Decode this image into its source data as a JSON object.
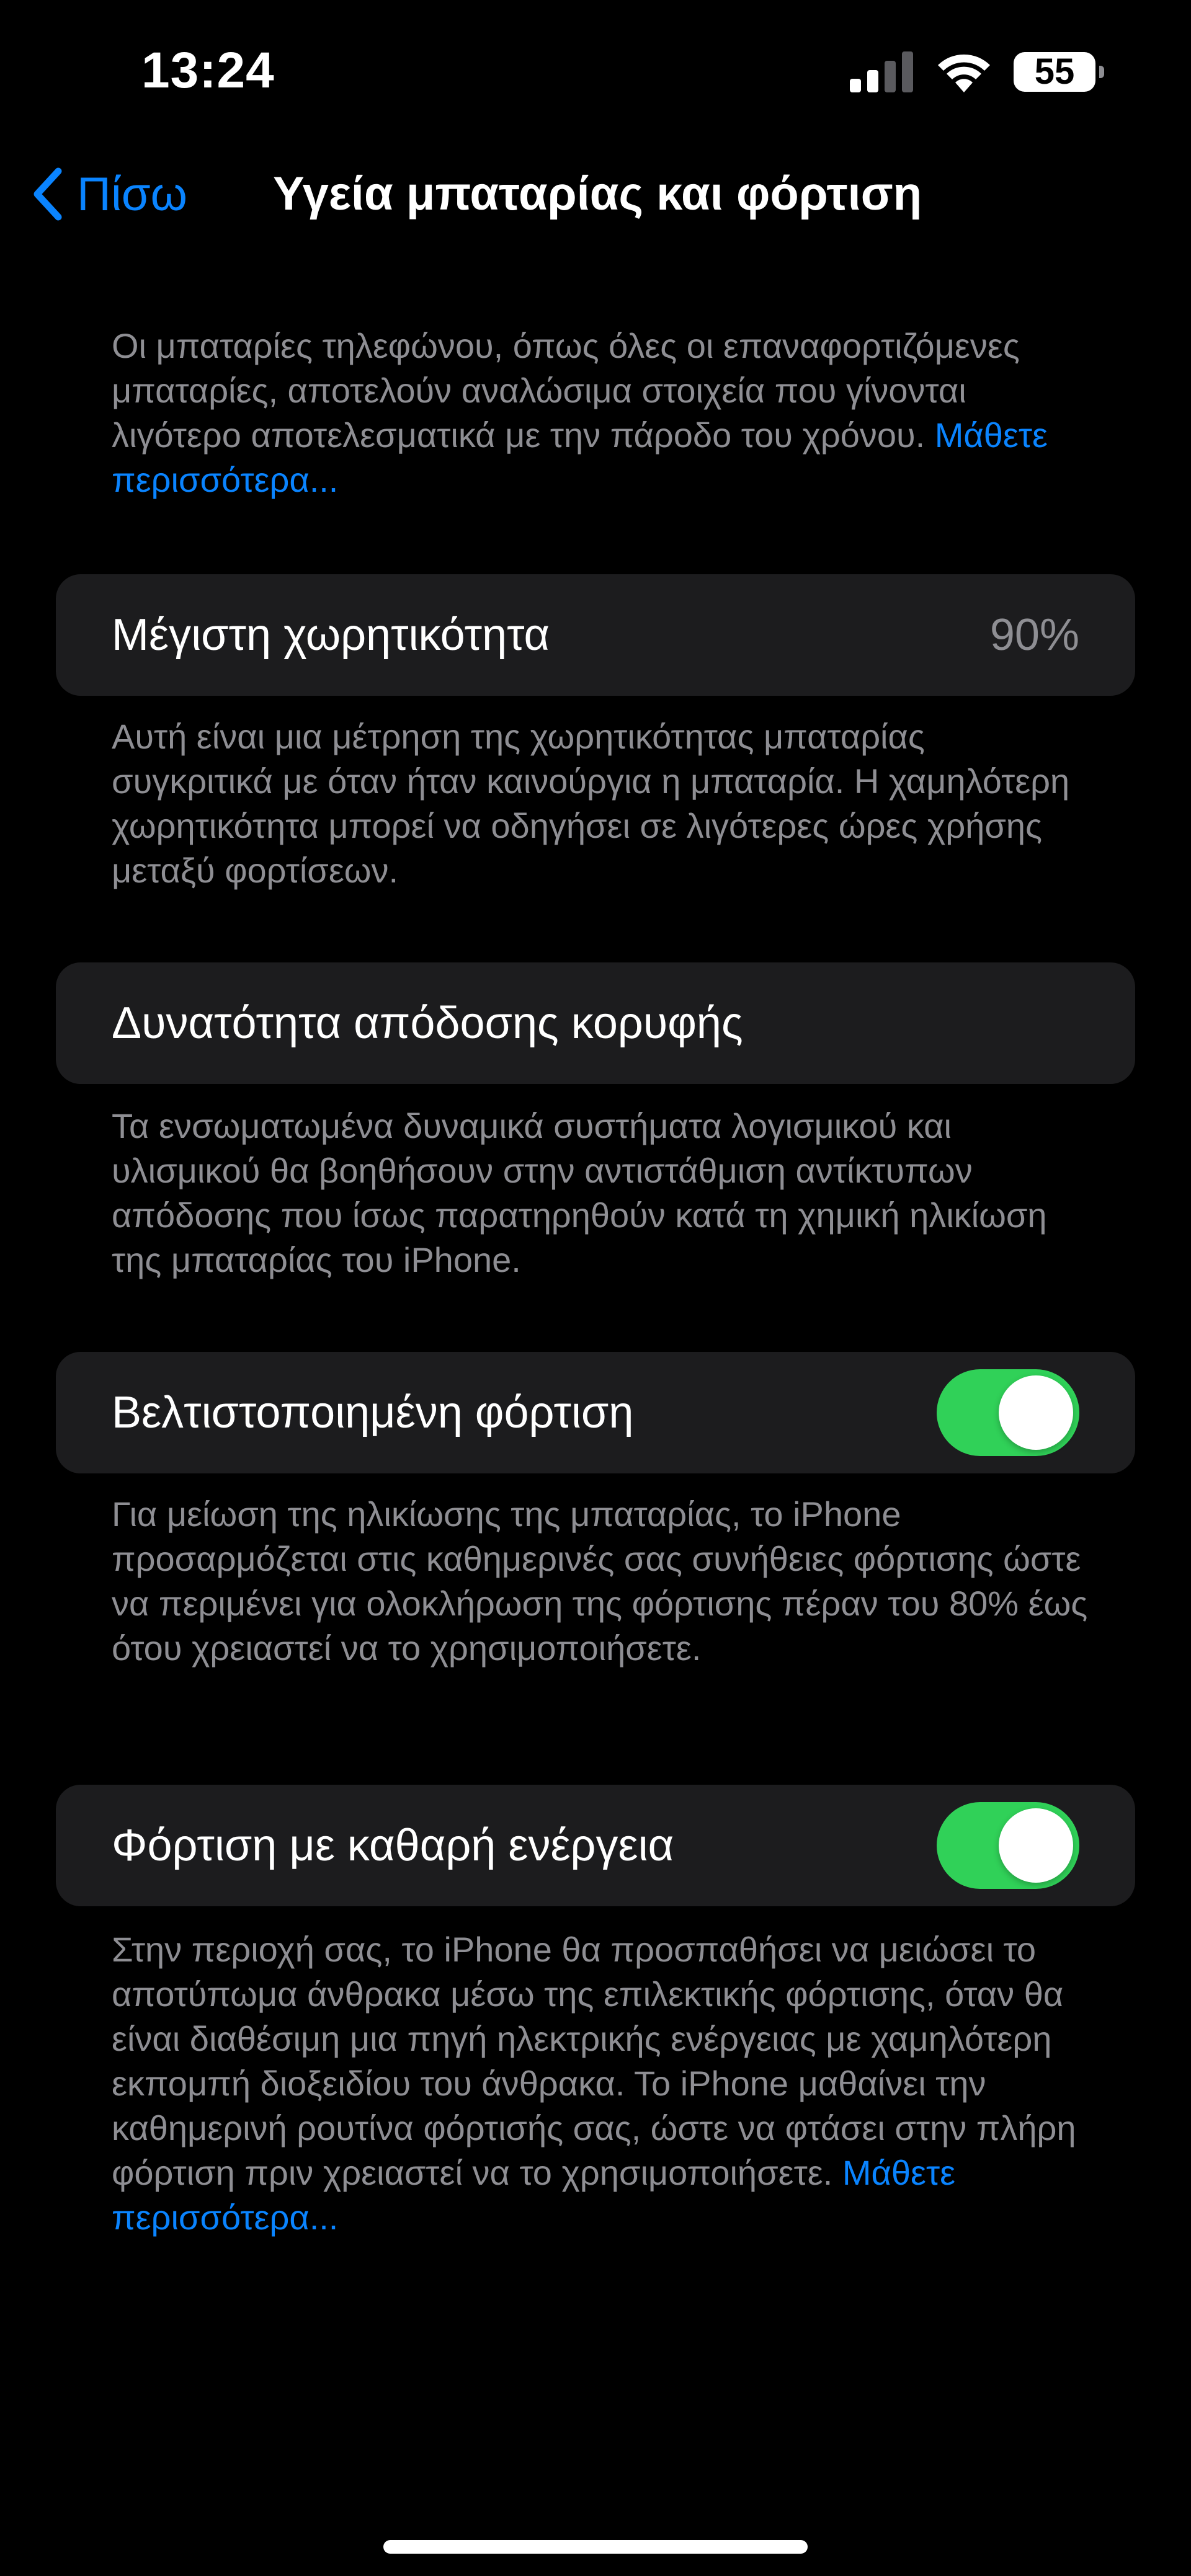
{
  "status_bar": {
    "time": "13:24",
    "battery_level": "55"
  },
  "nav": {
    "back_label": "Πίσω",
    "title": "Υγεία μπαταρίας και φόρτιση"
  },
  "intro": {
    "text": "Οι μπαταρίες τηλεφώνου, όπως όλες οι επαναφορτιζόμενες μπαταρίες, αποτελούν αναλώσιμα στοιχεία που γίνονται λιγότερο αποτελεσματικά με την πάροδο του χρόνου.",
    "link": "Μάθετε περισσότερα..."
  },
  "max_capacity": {
    "label": "Μέγιστη χωρητικότητα",
    "value": "90%",
    "footnote": "Αυτή είναι μια μέτρηση της χωρητικότητας μπαταρίας συγκριτικά με όταν ήταν καινούργια η μπαταρία. Η χαμηλότερη χωρητικότητα μπορεί να οδηγήσει σε λιγότερες ώρες χρήσης μεταξύ φορτίσεων."
  },
  "peak_performance": {
    "label": "Δυνατότητα απόδοσης κορυφής",
    "footnote": "Τα ενσωματωμένα δυναμικά συστήματα λογισμικού και υλισμικού θα βοηθήσουν στην αντιστάθμιση αντίκτυπων απόδοσης που ίσως παρατηρηθούν κατά τη χημική ηλικίωση της μπαταρίας του iPhone."
  },
  "optimized_charging": {
    "label": "Βελτιστοποιημένη φόρτιση",
    "enabled": true,
    "footnote": "Για μείωση της ηλικίωσης της μπαταρίας, το iPhone προσαρμόζεται στις καθημερινές σας συνήθειες φόρτισης ώστε να περιμένει για ολοκλήρωση της φόρτισης πέραν του 80% έως ότου χρειαστεί να το χρησιμοποιήσετε."
  },
  "clean_energy": {
    "label": "Φόρτιση με καθαρή ενέργεια",
    "enabled": true,
    "footnote": "Στην περιοχή σας, το iPhone θα προσπαθήσει να μειώσει το αποτύπωμα άνθρακα μέσω της επιλεκτικής φόρτισης, όταν θα είναι διαθέσιμη μια πηγή ηλεκτρικής ενέργειας με χαμηλότερη εκπομπή διοξειδίου του άνθρακα. Το iPhone μαθαίνει την καθημερινή ρουτίνα φόρτισής σας, ώστε να φτάσει στην πλήρη φόρτιση πριν χρειαστεί να το χρησιμοποιήσετε.",
    "link": "Μάθετε περισσότερα..."
  },
  "colors": {
    "background": "#000000",
    "cell": "#1c1c1e",
    "accent": "#0a84ff",
    "toggle_on": "#30d158",
    "secondary_text": "#8e8e93"
  }
}
